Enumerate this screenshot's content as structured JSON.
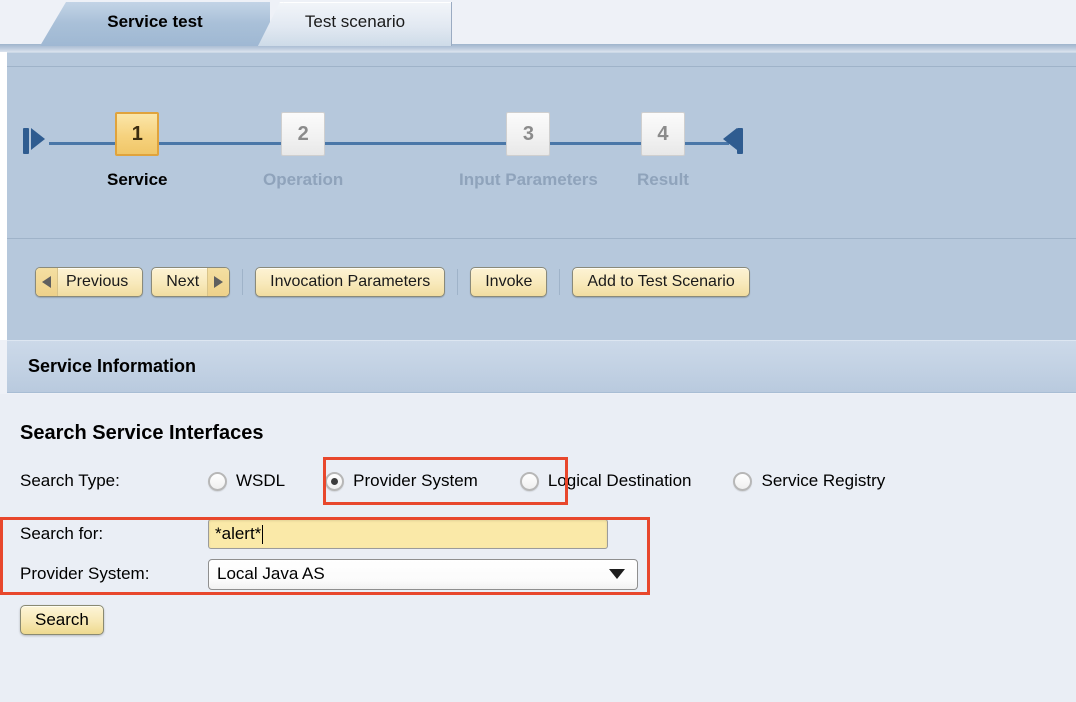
{
  "tabs": [
    {
      "label": "Service test",
      "active": true
    },
    {
      "label": "Test scenario",
      "active": false
    }
  ],
  "wizard": {
    "start_icon": "flow-start-icon",
    "end_icon": "flow-end-icon",
    "steps": [
      {
        "number": "1",
        "label": "Service",
        "state": "active"
      },
      {
        "number": "2",
        "label": "Operation",
        "state": "inactive"
      },
      {
        "number": "3",
        "label": "Input Parameters",
        "state": "inactive"
      },
      {
        "number": "4",
        "label": "Result",
        "state": "inactive"
      }
    ]
  },
  "toolbar": {
    "previous_label": "Previous",
    "next_label": "Next",
    "invocation_parameters_label": "Invocation Parameters",
    "invoke_label": "Invoke",
    "add_to_test_scenario_label": "Add to Test Scenario"
  },
  "section": {
    "title": "Service Information"
  },
  "search": {
    "heading": "Search Service Interfaces",
    "search_type_label": "Search Type:",
    "options": [
      {
        "label": "WSDL",
        "selected": false
      },
      {
        "label": "Provider System",
        "selected": true
      },
      {
        "label": "Logical Destination",
        "selected": false
      },
      {
        "label": "Service Registry",
        "selected": false
      }
    ],
    "search_for_label": "Search for:",
    "search_for_value": "*alert*",
    "provider_system_label": "Provider System:",
    "provider_system_value": "Local Java AS",
    "search_button_label": "Search"
  },
  "colors": {
    "annotation": "#e8472c",
    "panel_blue": "#b6c8dc",
    "active_step": "#f6d27e",
    "input_yellow": "#fae9a8"
  }
}
